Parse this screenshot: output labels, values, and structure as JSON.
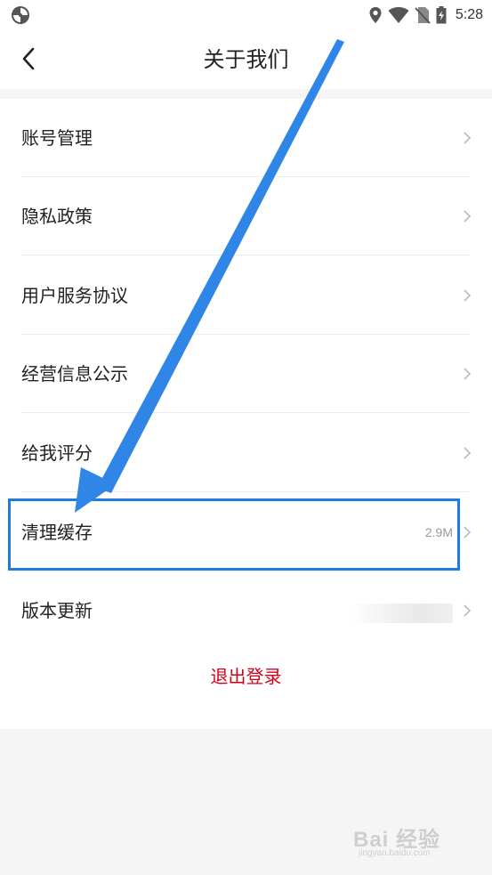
{
  "status_bar": {
    "time": "5:28",
    "icons": [
      "app-logo-icon",
      "location-icon",
      "wifi-icon",
      "no-sim-icon",
      "battery-charging-icon"
    ]
  },
  "header": {
    "title": "关于我们",
    "back_icon": "chevron-left-icon"
  },
  "menu": {
    "items": [
      {
        "label": "账号管理",
        "value": ""
      },
      {
        "label": "隐私政策",
        "value": ""
      },
      {
        "label": "用户服务协议",
        "value": ""
      },
      {
        "label": "经营信息公示",
        "value": ""
      },
      {
        "label": "给我评分",
        "value": ""
      },
      {
        "label": "清理缓存",
        "value": "2.9M"
      },
      {
        "label": "版本更新",
        "value": ""
      }
    ],
    "logout_label": "退出登录"
  },
  "annotation": {
    "highlight_color": "#1e7be0",
    "arrow_color": "#2f86e6",
    "highlighted_item": "清理缓存"
  },
  "watermark": {
    "text": "Bai 经验",
    "sub": "jingyan.baidu.com"
  },
  "colors": {
    "logout": "#d0021b",
    "background": "#f5f5f5",
    "text": "#222222",
    "secondary_text": "#999999"
  }
}
